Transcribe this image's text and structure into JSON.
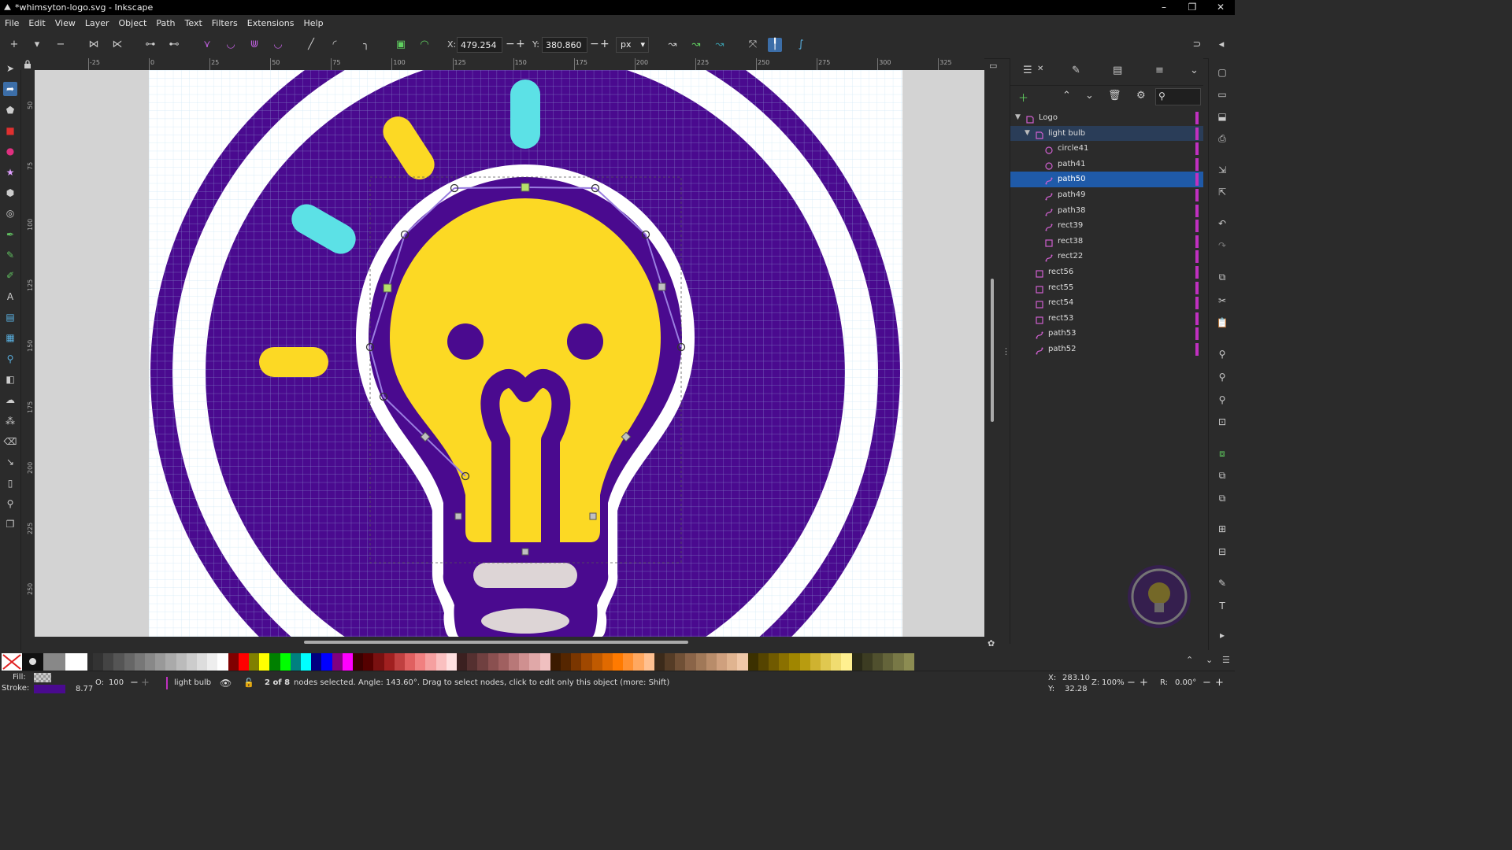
{
  "window": {
    "title": "*whimsyton-logo.svg - Inkscape",
    "controls": [
      "–",
      "❐",
      "✕"
    ]
  },
  "menu": [
    "File",
    "Edit",
    "View",
    "Layer",
    "Object",
    "Path",
    "Text",
    "Filters",
    "Extensions",
    "Help"
  ],
  "toolbar": {
    "x_label": "X:",
    "x_value": "479.254",
    "y_label": "Y:",
    "y_value": "380.860",
    "unit": "px",
    "minus": "−",
    "plus": "+"
  },
  "ruler": {
    "top_labels": [
      "-25",
      "0",
      "25",
      "50",
      "75",
      "100",
      "125",
      "150",
      "175",
      "200",
      "225",
      "250",
      "275",
      "300",
      "325"
    ],
    "left_labels": [
      "50",
      "75",
      "100",
      "125",
      "150",
      "175",
      "200",
      "225",
      "250"
    ]
  },
  "layers": {
    "items": [
      {
        "name": "Logo",
        "type": "layer",
        "depth": 0,
        "expanded": true
      },
      {
        "name": "light bulb",
        "type": "group",
        "depth": 1,
        "expanded": true
      },
      {
        "name": "circle41",
        "type": "circle",
        "depth": 2
      },
      {
        "name": "path41",
        "type": "circle",
        "depth": 2
      },
      {
        "name": "path50",
        "type": "path",
        "depth": 2,
        "selected": true
      },
      {
        "name": "path49",
        "type": "path",
        "depth": 2
      },
      {
        "name": "path38",
        "type": "path",
        "depth": 2
      },
      {
        "name": "rect39",
        "type": "path",
        "depth": 2
      },
      {
        "name": "rect38",
        "type": "rect",
        "depth": 2
      },
      {
        "name": "rect22",
        "type": "path",
        "depth": 2
      },
      {
        "name": "rect56",
        "type": "rect",
        "depth": 1
      },
      {
        "name": "rect55",
        "type": "rect",
        "depth": 1
      },
      {
        "name": "rect54",
        "type": "rect",
        "depth": 1
      },
      {
        "name": "rect53",
        "type": "rect",
        "depth": 1
      },
      {
        "name": "path53",
        "type": "path",
        "depth": 1
      },
      {
        "name": "path52",
        "type": "path",
        "depth": 1
      }
    ]
  },
  "status": {
    "fill_label": "Fill:",
    "stroke_label": "Stroke:",
    "stroke_width": "8.77",
    "opacity_label": "O:",
    "opacity_value": "100",
    "layer_name": "light bulb",
    "message_bold": "2 of 8",
    "message": " nodes selected. Angle: 143.60°. Drag to select nodes, click to edit only this object (more: Shift)",
    "cursor_x_label": "X:",
    "cursor_x": "283.10",
    "cursor_y_label": "Y:",
    "cursor_y": "32.28",
    "zoom_label": "Z:",
    "zoom": "100%",
    "rotation_label": "R:",
    "rotation": "0.00°"
  },
  "colors": {
    "purple": "#4a0a8f",
    "yellow": "#fcd924",
    "cyan": "#5ce1e6",
    "light_gray": "#ddd5d6",
    "white": "#ffffff",
    "selection": "#1f5aa8",
    "stroke_swatch": "#4a0a8f"
  }
}
